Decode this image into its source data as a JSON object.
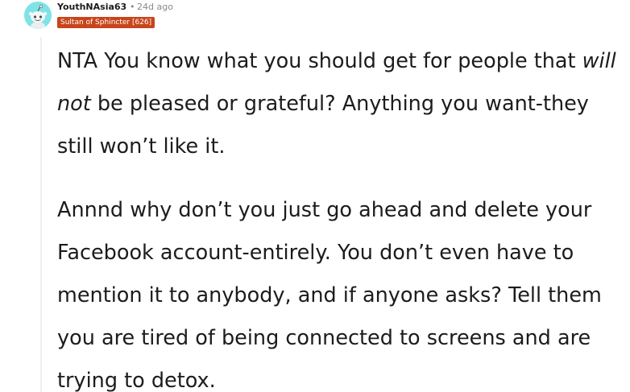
{
  "comment": {
    "author": "YouthNAsia63",
    "separator": "•",
    "timestamp": "24d ago",
    "flair": "Sultan of Sphincter [626]",
    "paragraph1": {
      "before": "NTA You know what you should get for people that ",
      "emphasis": "will not",
      "after": " be pleased or grateful? Anything you want-they still won’t like it."
    },
    "paragraph2": "Annnd why don’t you just go ahead and delete your Facebook account-entirely. You don’t even have to mention it to anybody, and if anyone asks? Tell them you are tired of being connected to screens and are trying to detox."
  },
  "colors": {
    "avatar_bg": "#7ee3e6",
    "flair_bg": "#c8451b",
    "meta_text": "#878a8c",
    "body_text": "#1c1c1c"
  },
  "icons": {
    "avatar": "snoo-avatar-icon"
  }
}
